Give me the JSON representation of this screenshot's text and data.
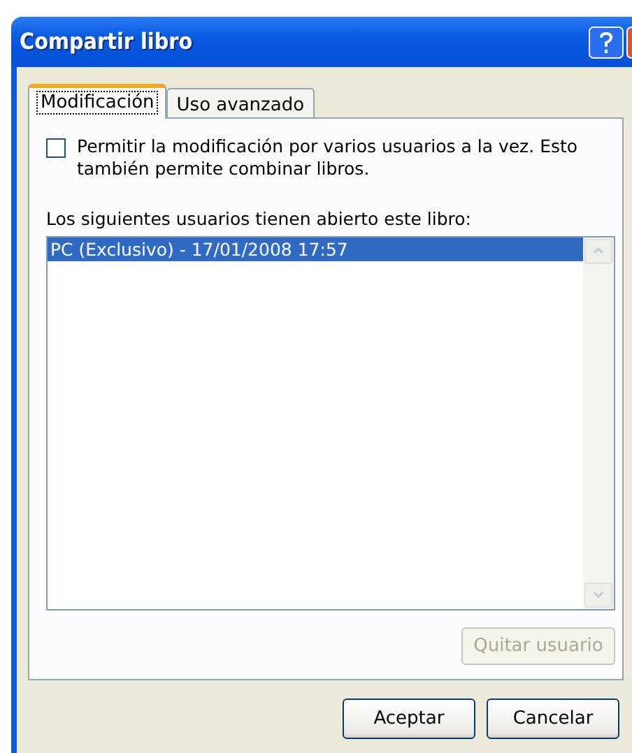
{
  "window": {
    "title": "Compartir libro"
  },
  "tabs": [
    {
      "label": "Modificación",
      "selected": true
    },
    {
      "label": "Uso avanzado",
      "selected": false
    }
  ],
  "checkbox": {
    "label": "Permitir la modificación por varios usuarios a la vez. Esto también permite combinar libros.",
    "checked": false
  },
  "users_list": {
    "label": "Los siguientes usuarios tienen abierto este libro:",
    "items": [
      {
        "text": "PC (Exclusivo) - 17/01/2008 17:57",
        "selected": true
      }
    ]
  },
  "remove_button": {
    "label": "Quitar usuario",
    "disabled": true
  },
  "buttons": [
    {
      "label": "Aceptar"
    },
    {
      "label": "Cancelar"
    }
  ]
}
